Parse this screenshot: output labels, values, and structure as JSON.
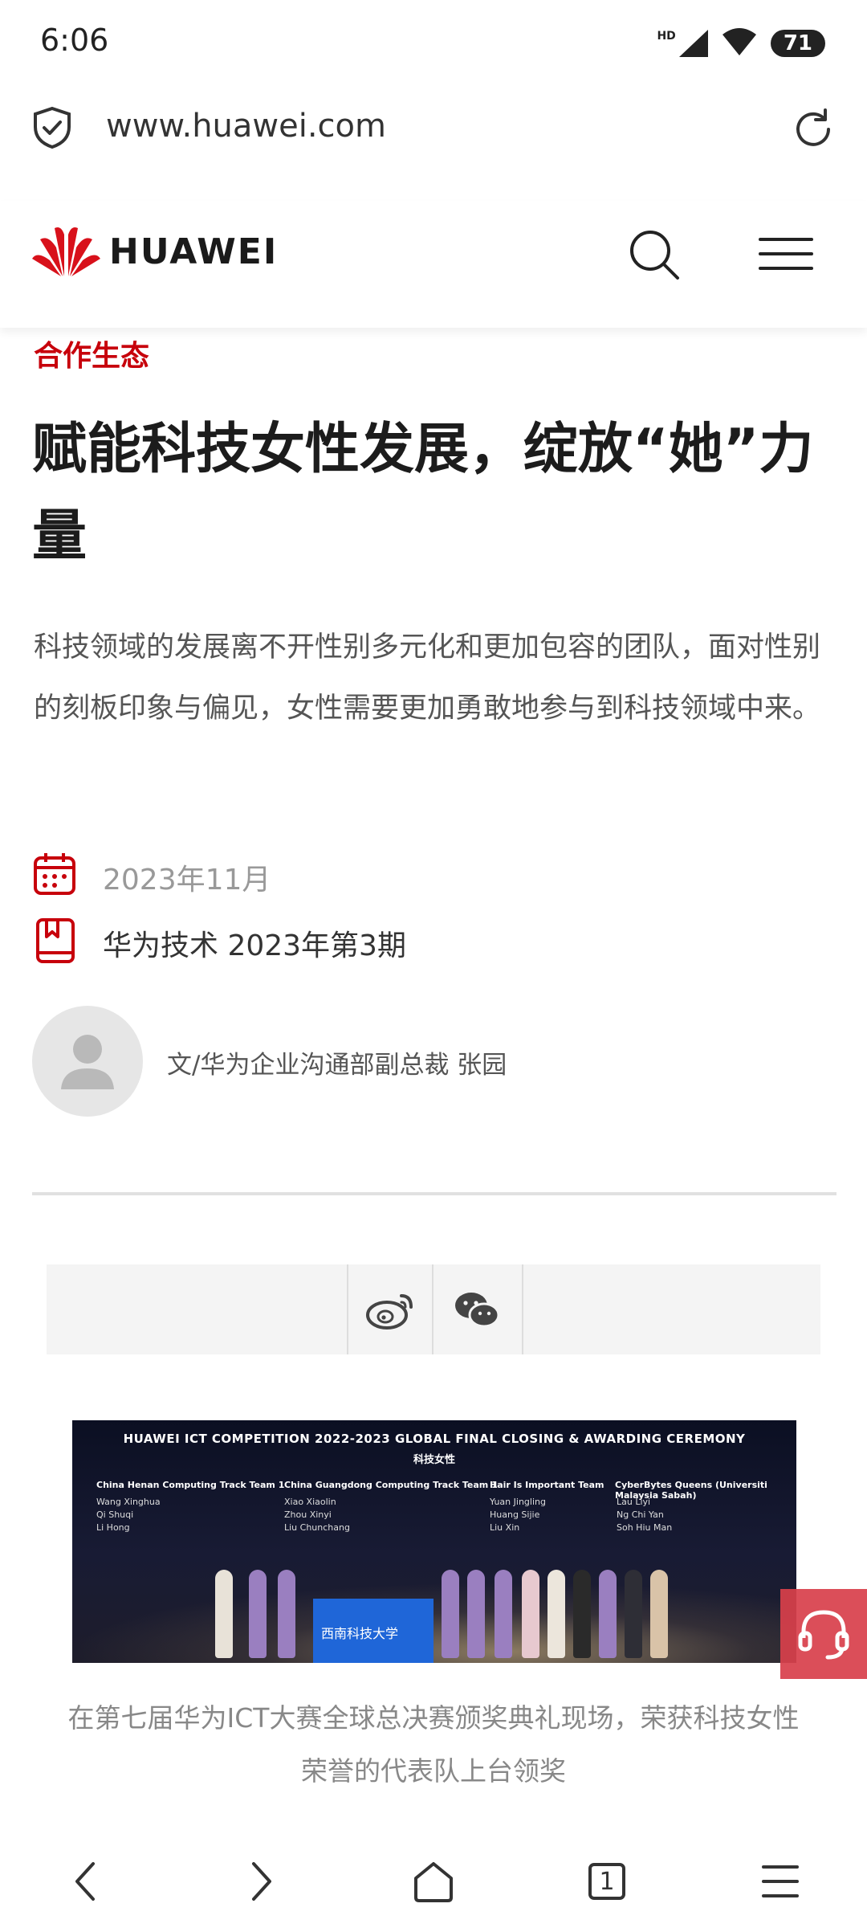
{
  "status_bar": {
    "time": "6:06",
    "network_label": "HD",
    "battery": "71"
  },
  "browser": {
    "url": "www.huawei.com"
  },
  "site": {
    "logo_text": "HUAWEI"
  },
  "article": {
    "category": "合作生态",
    "title": "赋能科技女性发展，绽放“她”力量",
    "summary": "科技领域的发展离不开性别多元化和更加包容的团队，面对性别的刻板印象与偏见，女性需要更加勇敢地参与到科技领域中来。",
    "date": "2023年11月",
    "issue": "华为技术 2023年第3期",
    "author": "文/华为企业沟通部副总裁 张园"
  },
  "share": {
    "weibo_icon": "weibo-icon",
    "wechat_icon": "wechat-icon"
  },
  "photo": {
    "headline": "HUAWEI ICT COMPETITION 2022-2023 GLOBAL FINAL CLOSING & AWARDING CEREMONY",
    "subheadline": "科技女性",
    "teams": [
      {
        "name": "China Henan Computing Track Team 1",
        "members": "Wang Xinghua\nQi Shuqi\nLi Hong"
      },
      {
        "name": "China Guangdong Computing Track Team 1",
        "members": "Xiao Xiaolin\nZhou Xinyi\nLiu Chunchang"
      },
      {
        "name": "Hair Is Important Team",
        "members": "Yuan Jingling\nHuang Sijie\nLiu Xin"
      },
      {
        "name": "CyberBytes Queens (Universiti Malaysia Sabah)",
        "members": "Lau Liyi\nNg Chi Yan\nSoh Hiu Man"
      }
    ],
    "banner_text": "西南科技大学",
    "caption": "在第七届华为ICT大赛全球总决赛颁奖典礼现场，荣获科技女性荣誉的代表队上台领奖"
  },
  "nav": {
    "tab_count": "1"
  },
  "colors": {
    "brand_red": "#c7000b",
    "text_dark": "#1c1c1c",
    "text_muted": "#888888"
  }
}
